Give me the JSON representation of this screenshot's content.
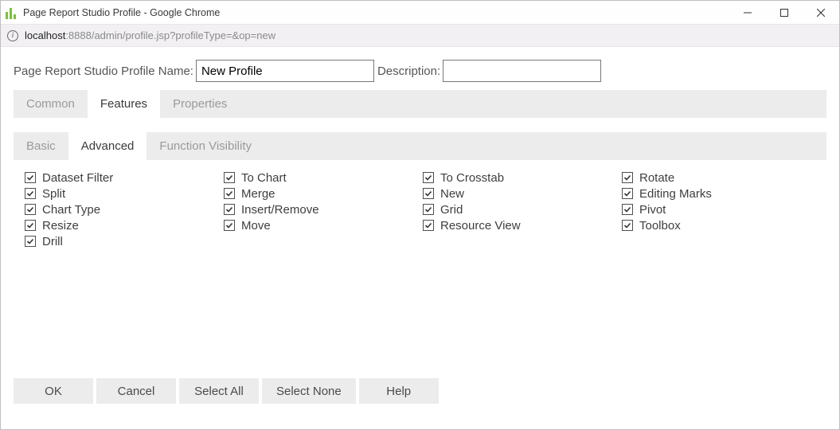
{
  "window": {
    "title": "Page Report Studio Profile - Google Chrome"
  },
  "address": {
    "host": "localhost",
    "path": ":8888/admin/profile.jsp?profileType=&op=new",
    "info_glyph": "i"
  },
  "form": {
    "name_label": "Page Report Studio Profile Name:",
    "name_value": "New Profile",
    "desc_label": "Description:",
    "desc_value": ""
  },
  "tabs": [
    {
      "label": "Common",
      "active": false
    },
    {
      "label": "Features",
      "active": true
    },
    {
      "label": "Properties",
      "active": false
    }
  ],
  "sub_tabs": [
    {
      "label": "Basic",
      "active": false
    },
    {
      "label": "Advanced",
      "active": true
    },
    {
      "label": "Function Visibility",
      "active": false
    }
  ],
  "feature_columns": [
    [
      {
        "label": "Dataset Filter",
        "checked": true
      },
      {
        "label": "Split",
        "checked": true
      },
      {
        "label": "Chart Type",
        "checked": true
      },
      {
        "label": "Resize",
        "checked": true
      },
      {
        "label": "Drill",
        "checked": true
      }
    ],
    [
      {
        "label": "To Chart",
        "checked": true
      },
      {
        "label": "Merge",
        "checked": true
      },
      {
        "label": "Insert/Remove",
        "checked": true
      },
      {
        "label": "Move",
        "checked": true
      }
    ],
    [
      {
        "label": "To Crosstab",
        "checked": true
      },
      {
        "label": "New",
        "checked": true
      },
      {
        "label": "Grid",
        "checked": true
      },
      {
        "label": "Resource View",
        "checked": true
      }
    ],
    [
      {
        "label": "Rotate",
        "checked": true
      },
      {
        "label": "Editing Marks",
        "checked": true
      },
      {
        "label": "Pivot",
        "checked": true
      },
      {
        "label": "Toolbox",
        "checked": true
      }
    ]
  ],
  "buttons": {
    "ok": "OK",
    "cancel": "Cancel",
    "select_all": "Select All",
    "select_none": "Select None",
    "help": "Help"
  }
}
